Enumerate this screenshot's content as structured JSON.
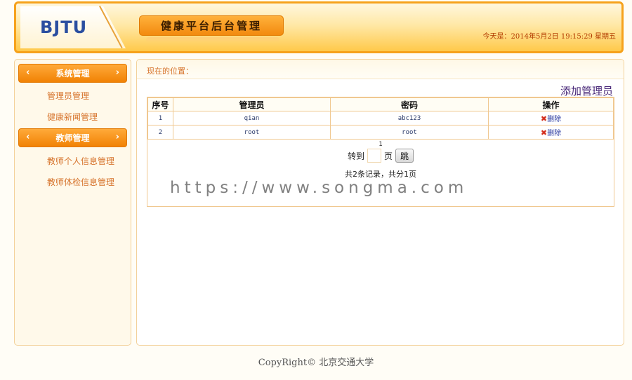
{
  "header": {
    "logo": "BJTU",
    "platform_title": "健康平台后台管理",
    "datetime": "今天是：2014年5月2日 19:15:29 星期五"
  },
  "sidebar": {
    "sections": [
      {
        "title": "系统管理",
        "items": [
          {
            "label": "管理员管理"
          },
          {
            "label": "健康新闻管理"
          }
        ]
      },
      {
        "title": "教师管理",
        "items": [
          {
            "label": "教师个人信息管理"
          },
          {
            "label": "教师体检信息管理"
          }
        ]
      }
    ]
  },
  "main": {
    "location_label": "现在的位置：",
    "add_link": "添加管理员",
    "table": {
      "headers": [
        "序号",
        "管理员",
        "密码",
        "操作"
      ],
      "rows": [
        {
          "no": "1",
          "admin": "qian",
          "password": "abc123",
          "action": "删除"
        },
        {
          "no": "2",
          "admin": "root",
          "password": "root",
          "action": "删除"
        }
      ]
    },
    "pager": {
      "current_page": "1",
      "goto_label": "转到",
      "page_unit": "页",
      "go_button": "跳",
      "summary": "共2条记录，共分1页"
    },
    "watermark": "https://www.songma.com"
  },
  "footer": {
    "copyright": "CopyRight© 北京交通大学"
  }
}
